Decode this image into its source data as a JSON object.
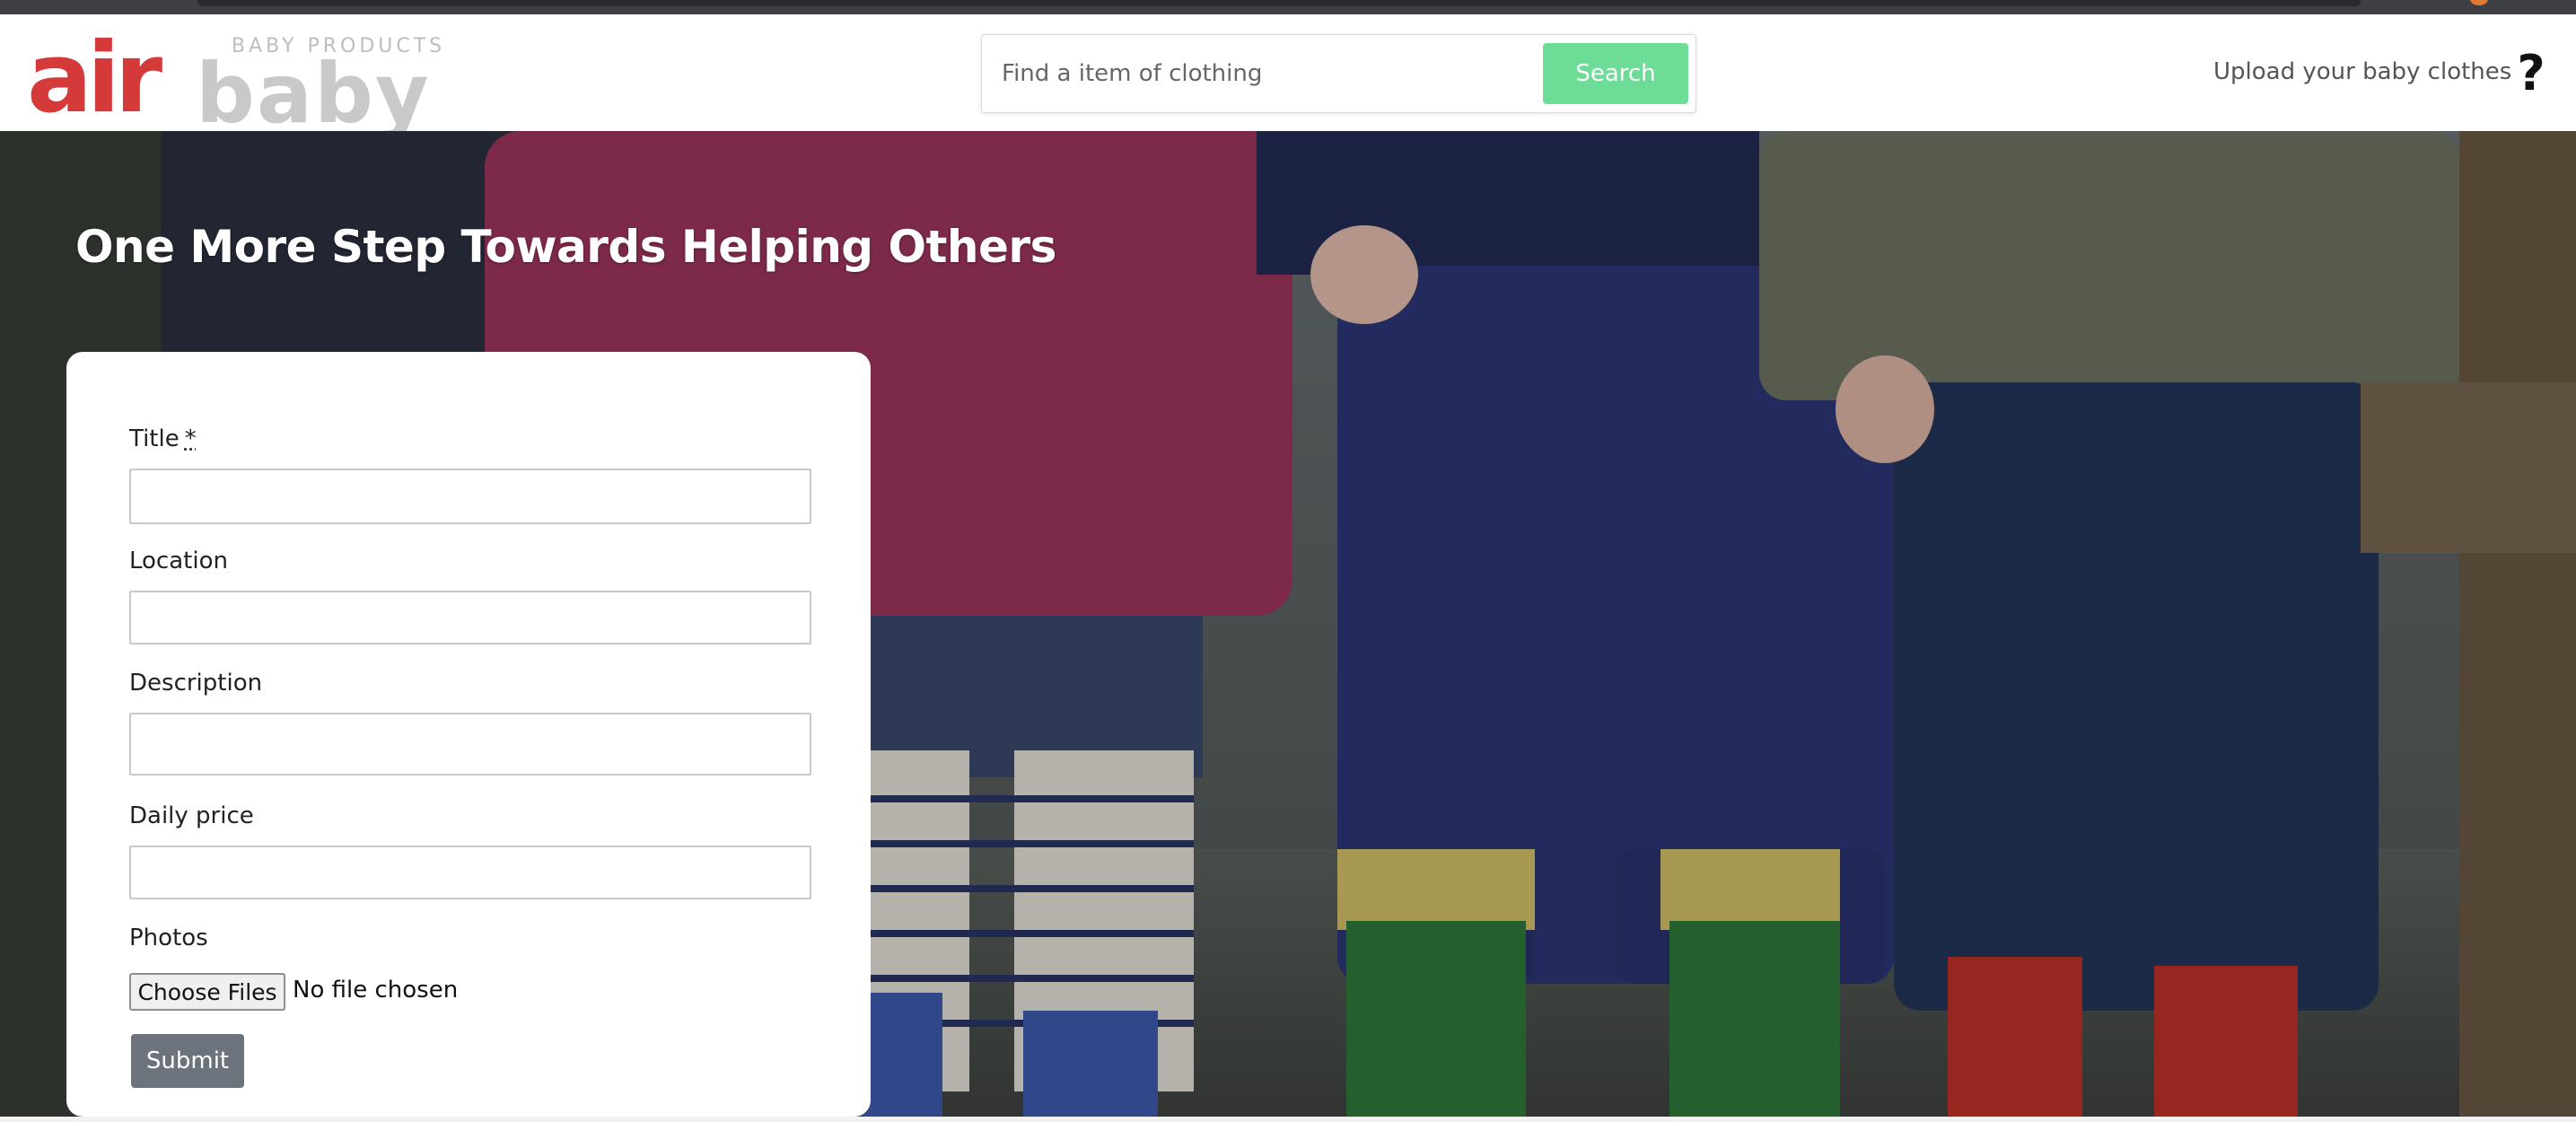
{
  "brand": {
    "logo_text_primary": "air",
    "logo_text_secondary": "baby",
    "logo_tagline": "BABY PRODUCTS",
    "primary_color": "#d43a3a",
    "secondary_color": "#c9c9c9"
  },
  "navbar": {
    "search_placeholder": "Find a item of clothing",
    "search_value": "",
    "search_button_label": "Search",
    "search_button_color": "#6ddc97",
    "upload_link_label": "Upload your baby clothes",
    "help_icon": "question-icon",
    "help_glyph": "?"
  },
  "hero": {
    "title": "One More Step Towards Helping Others"
  },
  "form": {
    "title_label": "Title",
    "title_required_marker": "*",
    "title_value": "",
    "location_label": "Location",
    "location_value": "",
    "description_label": "Description",
    "description_value": "",
    "daily_price_label": "Daily price",
    "daily_price_value": "",
    "photos_label": "Photos",
    "file_button_label": "Choose Files",
    "file_status": "No file chosen",
    "submit_label": "Submit",
    "submit_color": "#6c737c"
  }
}
